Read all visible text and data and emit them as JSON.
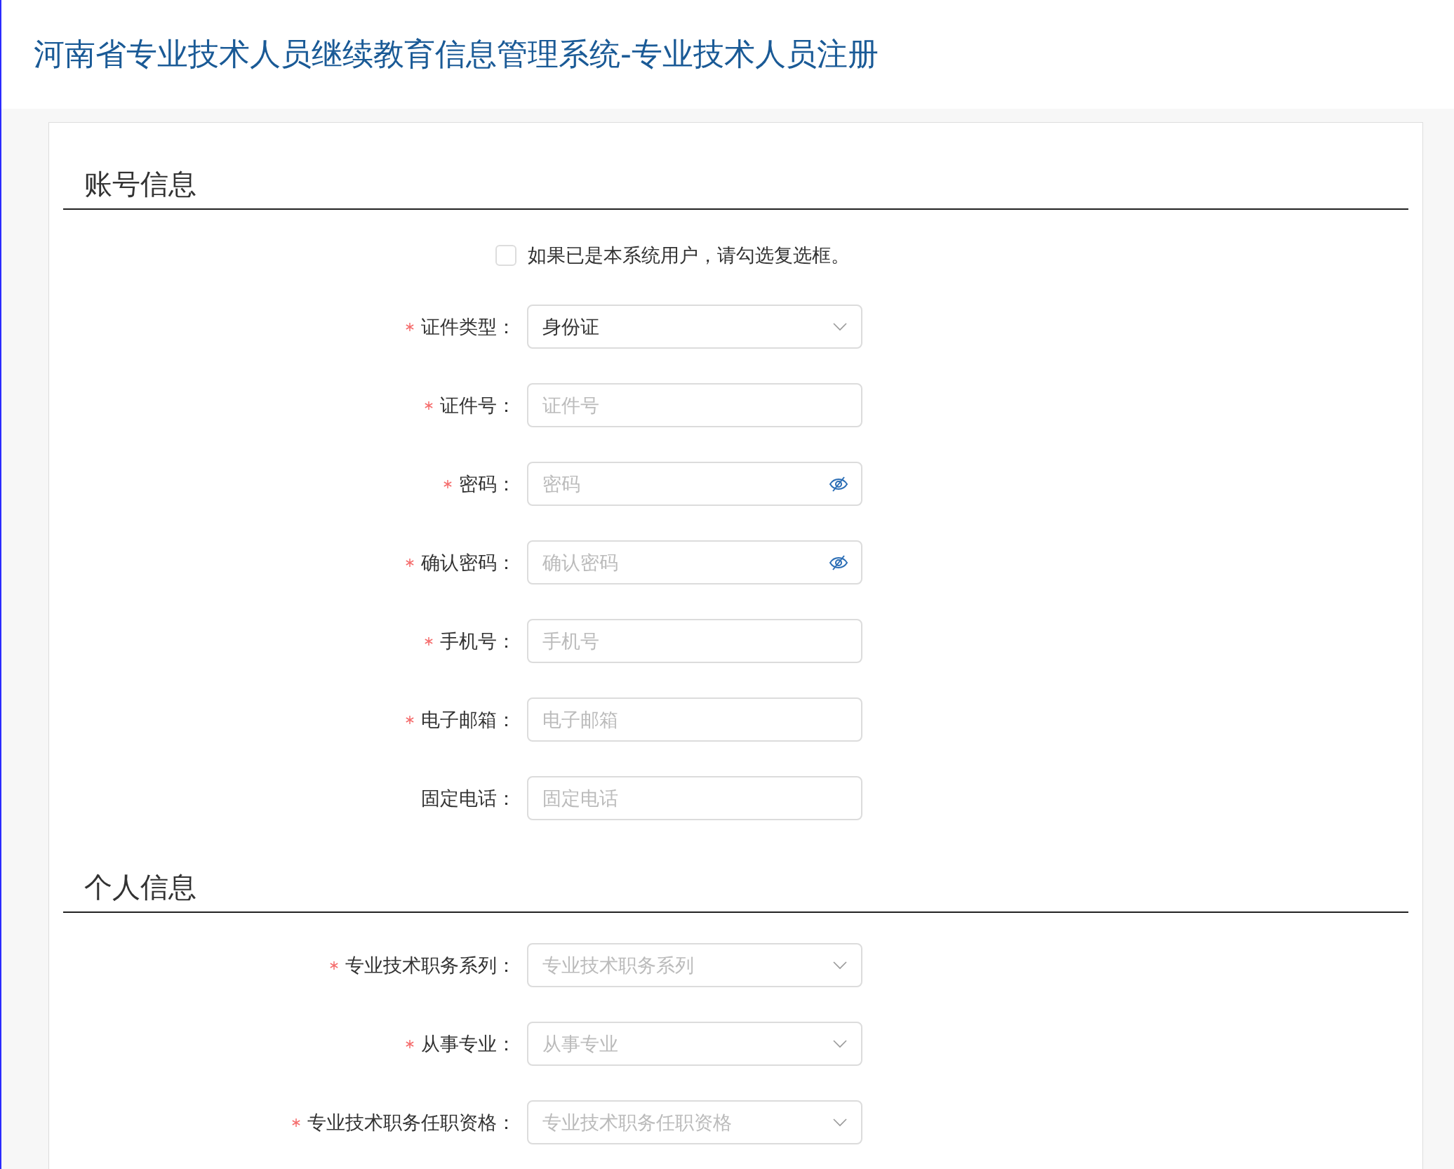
{
  "header": {
    "title": "河南省专业技术人员继续教育信息管理系统-专业技术人员注册"
  },
  "sections": [
    {
      "title": "账号信息",
      "existing_user": {
        "label": "如果已是本系统用户，请勾选复选框。",
        "checked": false
      },
      "fields": [
        {
          "kind": "select",
          "label": "证件类型：",
          "required": true,
          "value": "身份证"
        },
        {
          "kind": "input",
          "label": "证件号：",
          "required": true,
          "placeholder": "证件号"
        },
        {
          "kind": "password",
          "label": "密码：",
          "required": true,
          "placeholder": "密码"
        },
        {
          "kind": "password",
          "label": "确认密码：",
          "required": true,
          "placeholder": "确认密码"
        },
        {
          "kind": "input",
          "label": "手机号：",
          "required": true,
          "placeholder": "手机号"
        },
        {
          "kind": "input",
          "label": "电子邮箱：",
          "required": true,
          "placeholder": "电子邮箱"
        },
        {
          "kind": "input",
          "label": "固定电话：",
          "required": false,
          "placeholder": "固定电话"
        }
      ]
    },
    {
      "title": "个人信息",
      "fields": [
        {
          "kind": "select",
          "label": "专业技术职务系列：",
          "required": true,
          "placeholder": "专业技术职务系列"
        },
        {
          "kind": "select",
          "label": "从事专业：",
          "required": true,
          "placeholder": "从事专业"
        },
        {
          "kind": "select",
          "label": "专业技术职务任职资格：",
          "required": true,
          "placeholder": "专业技术职务任职资格"
        }
      ]
    }
  ]
}
